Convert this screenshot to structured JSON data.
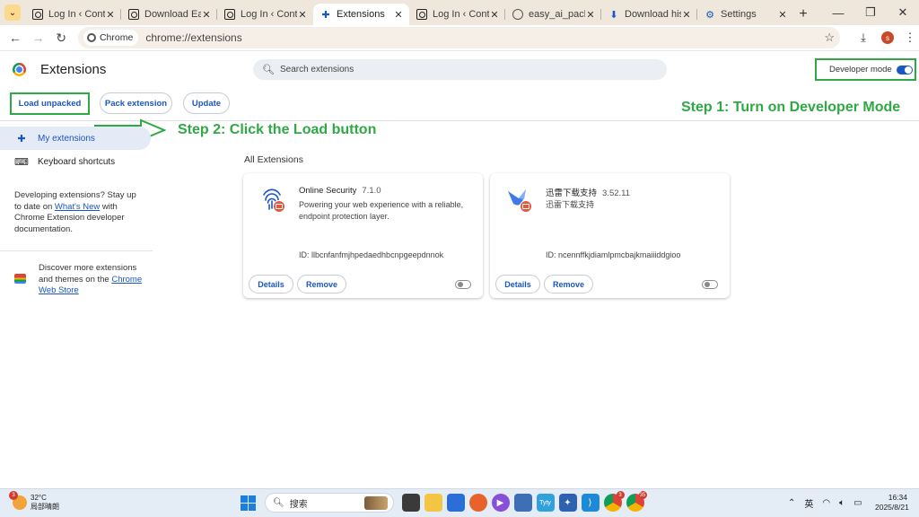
{
  "tabs": [
    {
      "title": "Log In ‹ Conte",
      "icon": "wordpress-icon",
      "active": false
    },
    {
      "title": "Download Easy",
      "icon": "wordpress-icon",
      "active": false
    },
    {
      "title": "Log In ‹ Conte",
      "icon": "wordpress-icon",
      "active": false
    },
    {
      "title": "Extensions",
      "icon": "puzzle-icon",
      "active": true
    },
    {
      "title": "Log In ‹ Conte",
      "icon": "wordpress-icon",
      "active": false
    },
    {
      "title": "easy_ai_packag",
      "icon": "globe-icon",
      "active": false
    },
    {
      "title": "Download histo",
      "icon": "download-icon",
      "active": false
    },
    {
      "title": "Settings",
      "icon": "gear-icon",
      "active": false
    }
  ],
  "toolbar": {
    "chip_label": "Chrome",
    "url": "chrome://extensions",
    "profile_letter": "s"
  },
  "header": {
    "title": "Extensions",
    "search_placeholder": "Search extensions",
    "developer_mode_label": "Developer mode"
  },
  "actions": {
    "load_unpacked": "Load unpacked",
    "pack_extension": "Pack extension",
    "update": "Update"
  },
  "annotations": {
    "step1": "Step 1: Turn on Developer Mode",
    "step2": "Step 2: Click the Load button"
  },
  "sidebar": {
    "my_extensions": "My extensions",
    "keyboard_shortcuts": "Keyboard shortcuts",
    "dev_text_1": "Developing extensions? Stay up to date on ",
    "whats_new": "What's New",
    "dev_text_2": " with Chrome Extension developer documentation.",
    "discover_text": "Discover more extensions and themes on the ",
    "web_store": "Chrome Web Store"
  },
  "main": {
    "section_label": "All Extensions",
    "cards": [
      {
        "name": "Online Security",
        "version": "7.1.0",
        "description": "Powering your web experience with a reliable, endpoint protection layer.",
        "id": "ID: llbcnfanfmjhpedaedhbcnpgeepdnnok",
        "details_label": "Details",
        "remove_label": "Remove",
        "enabled": false
      },
      {
        "name": "迅雷下载支持",
        "version": "3.52.11",
        "description": "迅雷下载支持",
        "id": "ID: ncennffkjdiamlpmcbajkmaiiiddgioo",
        "details_label": "Details",
        "remove_label": "Remove",
        "enabled": false
      }
    ]
  },
  "taskbar": {
    "weather_temp": "32°C",
    "weather_desc": "局部晴朗",
    "weather_badge": "3",
    "search_label": "搜索",
    "ime": "英",
    "time": "16:34",
    "date": "2025/8/21",
    "chrome_badge_1": "3",
    "chrome_badge_2": "35"
  },
  "colors": {
    "accent_blue": "#1a56c4",
    "annotation_green": "#2fa845"
  }
}
